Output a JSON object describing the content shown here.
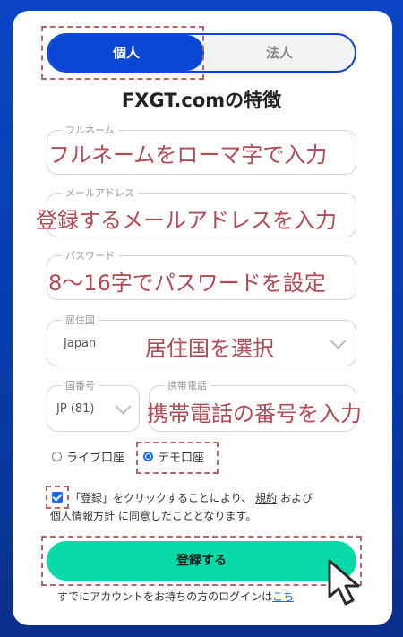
{
  "tabs": {
    "individual": "個人",
    "corporate": "法人"
  },
  "heading": "FXGT.comの特徴",
  "fields": {
    "fullname": {
      "label": "フルネーム",
      "hint": "フルネームをローマ字で入力"
    },
    "email": {
      "label": "メールアドレス",
      "hint": "登録するメールアドレスを入力"
    },
    "password": {
      "label": "パスワード",
      "hint": "8～16字でパスワードを設定"
    },
    "country": {
      "label": "居住国",
      "value": "Japan",
      "hint": "居住国を選択"
    },
    "phone_code": {
      "label": "国番号",
      "value": "JP (81)"
    },
    "phone": {
      "label": "携帯電話",
      "hint": "携帯電話の番号を入力"
    }
  },
  "account_type": {
    "live": "ライブ口座",
    "demo": "デモ口座",
    "selected": "demo"
  },
  "terms": {
    "part1": "「登録」をクリックすることにより、",
    "link1": "規約",
    "part2": "および",
    "link2": "個人情報方針",
    "part3": "に同意したこととなります。"
  },
  "submit_label": "登録する",
  "footer": {
    "text": "すでにアカウントをお持ちの方のログインは",
    "link": "こち"
  },
  "colors": {
    "primary": "#0a46d6",
    "submit": "#08d9a8",
    "annotation": "#b04a54"
  }
}
